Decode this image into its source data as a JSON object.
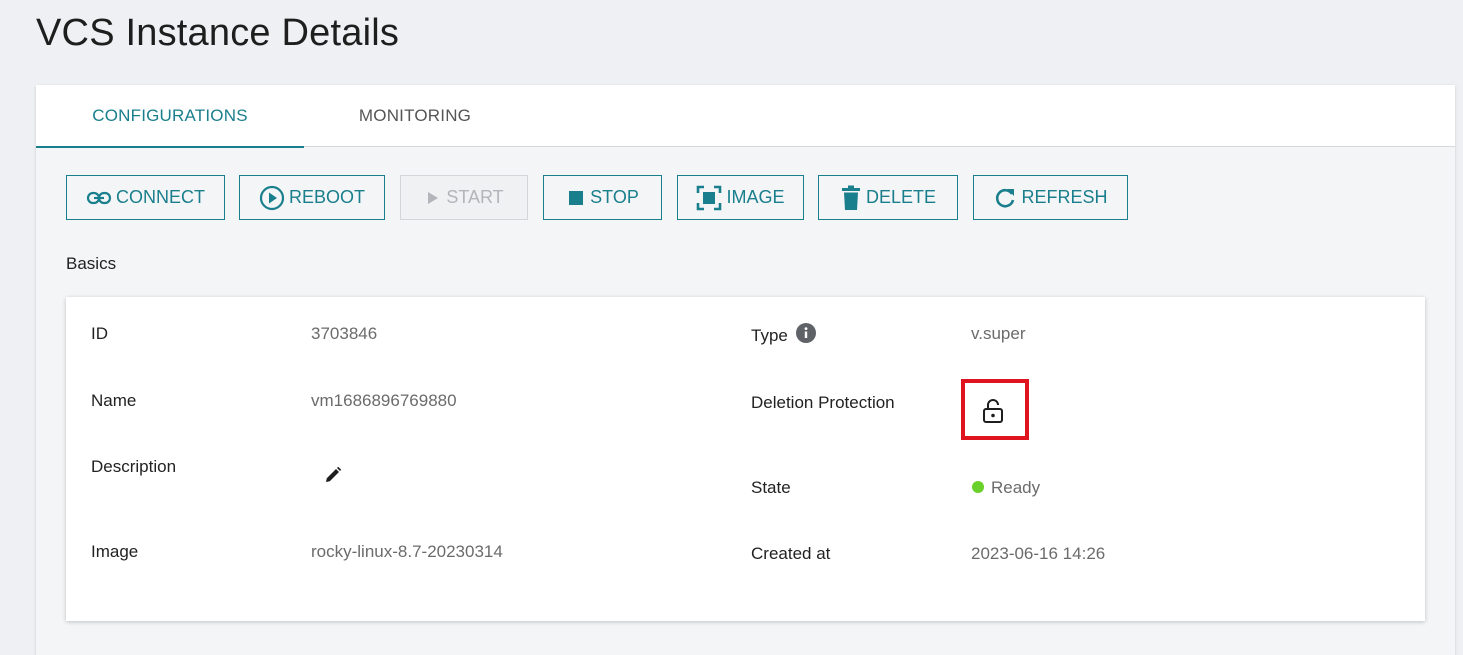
{
  "page": {
    "title": "VCS Instance Details"
  },
  "tabs": [
    {
      "label": "CONFIGURATIONS",
      "active": true
    },
    {
      "label": "MONITORING",
      "active": false
    }
  ],
  "toolbar": {
    "connect": "CONNECT",
    "reboot": "REBOOT",
    "start": "START",
    "stop": "STOP",
    "image": "IMAGE",
    "delete": "DELETE",
    "refresh": "REFRESH"
  },
  "basics": {
    "section_label": "Basics",
    "id_label": "ID",
    "id_value": "3703846",
    "name_label": "Name",
    "name_value": "vm1686896769880",
    "description_label": "Description",
    "image_label": "Image",
    "image_value": "rocky-linux-8.7-20230314",
    "type_label": "Type",
    "type_value": "v.super",
    "deletion_label": "Deletion Protection",
    "state_label": "State",
    "state_value": "Ready",
    "created_label": "Created at",
    "created_value": "2023-06-16 14:26"
  },
  "colors": {
    "accent": "#1a7f8c",
    "highlight": "#e0141e",
    "ready": "#6ad12a"
  },
  "icons": {
    "connect": "link-icon",
    "reboot": "play-circle-icon",
    "start": "play-icon",
    "stop": "stop-square-icon",
    "image": "screenshot-frame-icon",
    "delete": "trash-icon",
    "refresh": "refresh-icon",
    "type_info": "info-icon",
    "description_edit": "pencil-icon",
    "deletion_protection": "unlock-icon"
  }
}
